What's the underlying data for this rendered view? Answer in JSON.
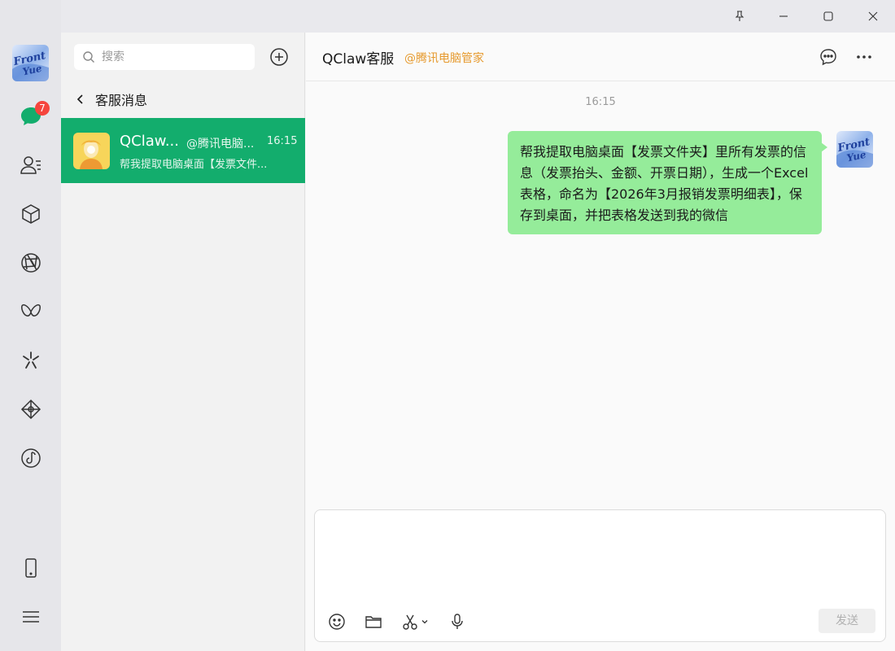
{
  "window": {
    "pin_icon": "pin-icon",
    "minimize_icon": "minimize-icon",
    "maximize_icon": "maximize-icon",
    "close_icon": "close-icon"
  },
  "rail": {
    "avatar_text_line1": "Front",
    "avatar_text_line2": "Yue",
    "chat_badge": "7",
    "items": [
      "chat-icon",
      "contacts-icon",
      "cube-icon",
      "aperture-icon",
      "butterfly-icon",
      "sparkle-icon",
      "diamond-icon",
      "music-icon"
    ],
    "bottom_items": [
      "phone-icon",
      "menu-icon"
    ]
  },
  "sidebar": {
    "search_placeholder": "搜索",
    "back_label": "客服消息",
    "conversations": [
      {
        "name": "QClaw...",
        "tag": "@腾讯电脑...",
        "time": "16:15",
        "preview": "帮我提取电脑桌面【发票文件..."
      }
    ]
  },
  "chat": {
    "title": "QClaw客服",
    "tag": "@腾讯电脑管家",
    "timestamp": "16:15",
    "messages": [
      {
        "from": "me",
        "text": "帮我提取电脑桌面【发票文件夹】里所有发票的信息（发票抬头、金额、开票日期），生成一个Excel表格，命名为【2026年3月报销发票明细表】，保存到桌面，并把表格发送到我的微信"
      }
    ],
    "send_label": "发送"
  },
  "colors": {
    "accent": "#13ad6d",
    "bubble": "#95ec9a",
    "badge": "#f5453d",
    "tag_orange": "#e69a2e"
  }
}
